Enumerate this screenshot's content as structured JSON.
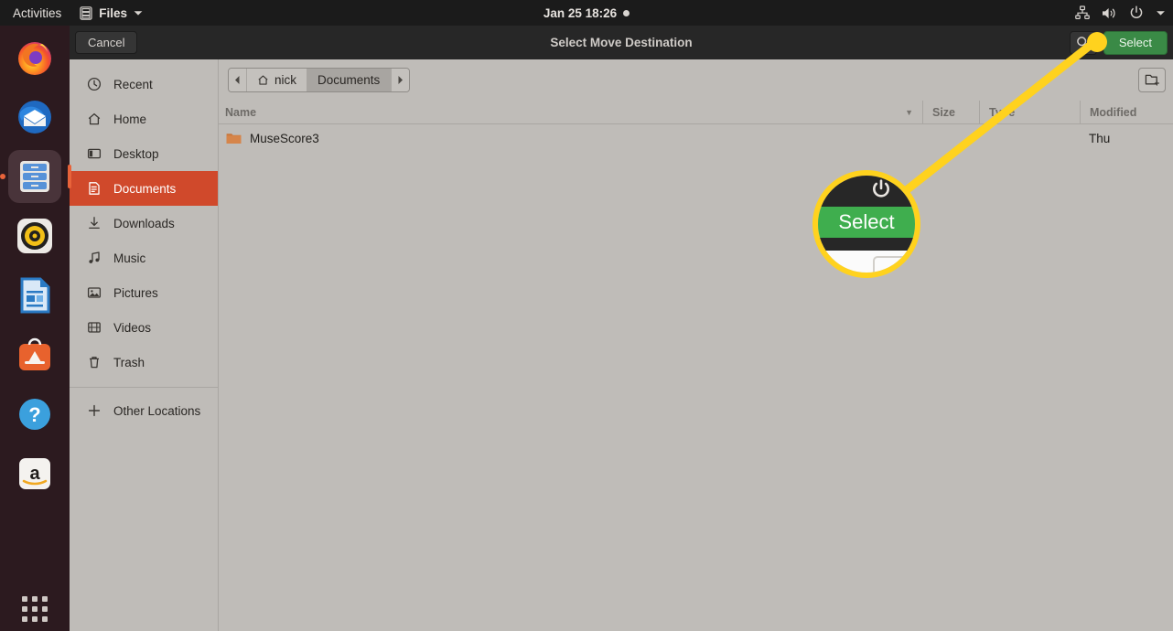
{
  "topbar": {
    "activities": "Activities",
    "app_name": "Files",
    "app_icon": "files-icon",
    "app_menu_chevron": "chevron-down-icon",
    "clock": "Jan 25  18:26",
    "indicator_dot": "recording-dot",
    "status_icons": [
      "network-icon",
      "volume-icon",
      "power-icon",
      "chevron-down-icon"
    ]
  },
  "dock": {
    "items": [
      {
        "name": "firefox",
        "label": "Firefox",
        "active": false
      },
      {
        "name": "thunderbird",
        "label": "Thunderbird",
        "active": false
      },
      {
        "name": "files",
        "label": "Files",
        "active": true
      },
      {
        "name": "rhythmbox",
        "label": "Rhythmbox",
        "active": false
      },
      {
        "name": "libreoffice-writer",
        "label": "LibreOffice Writer",
        "active": false
      },
      {
        "name": "ubuntu-software",
        "label": "Ubuntu Software",
        "active": false
      },
      {
        "name": "help",
        "label": "Help",
        "active": false
      },
      {
        "name": "amazon",
        "label": "Amazon",
        "active": false
      }
    ],
    "show_apps": "show-applications-grid"
  },
  "dialog": {
    "title": "Select Move Destination",
    "cancel_label": "Cancel",
    "select_label": "Select",
    "search_icon": "search-icon",
    "new_folder_icon": "new-folder-icon"
  },
  "sidebar": {
    "items": [
      {
        "label": "Recent",
        "icon": "clock-icon",
        "selected": false
      },
      {
        "label": "Home",
        "icon": "home-icon",
        "selected": false
      },
      {
        "label": "Desktop",
        "icon": "desktop-icon",
        "selected": false
      },
      {
        "label": "Documents",
        "icon": "document-icon",
        "selected": true
      },
      {
        "label": "Downloads",
        "icon": "download-icon",
        "selected": false
      },
      {
        "label": "Music",
        "icon": "music-note-icon",
        "selected": false
      },
      {
        "label": "Pictures",
        "icon": "picture-icon",
        "selected": false
      },
      {
        "label": "Videos",
        "icon": "video-icon",
        "selected": false
      },
      {
        "label": "Trash",
        "icon": "trash-icon",
        "selected": false
      }
    ],
    "other_locations": {
      "label": "Other Locations",
      "icon": "plus-icon"
    }
  },
  "pathbar": {
    "back_icon": "arrow-left-icon",
    "forward_icon": "arrow-right-icon",
    "crumbs": [
      {
        "label": "nick",
        "icon": "home-icon",
        "active": false
      },
      {
        "label": "Documents",
        "icon": "",
        "active": true
      }
    ]
  },
  "file_list": {
    "columns": [
      "Name",
      "Size",
      "Type",
      "Modified"
    ],
    "sort_indicator": "chevron-down-icon",
    "rows": [
      {
        "name": "MuseScore3",
        "icon": "folder-icon",
        "size": "",
        "type": "",
        "modified": "Thu"
      }
    ]
  },
  "annotation": {
    "callout_label": "Select",
    "marker": "yellow-dot-marker",
    "leader_line": "yellow-leader-line",
    "colors": {
      "highlight": "#ffd21e",
      "select_green": "#3a8a46",
      "selected_sidebar": "#d0492b"
    }
  }
}
